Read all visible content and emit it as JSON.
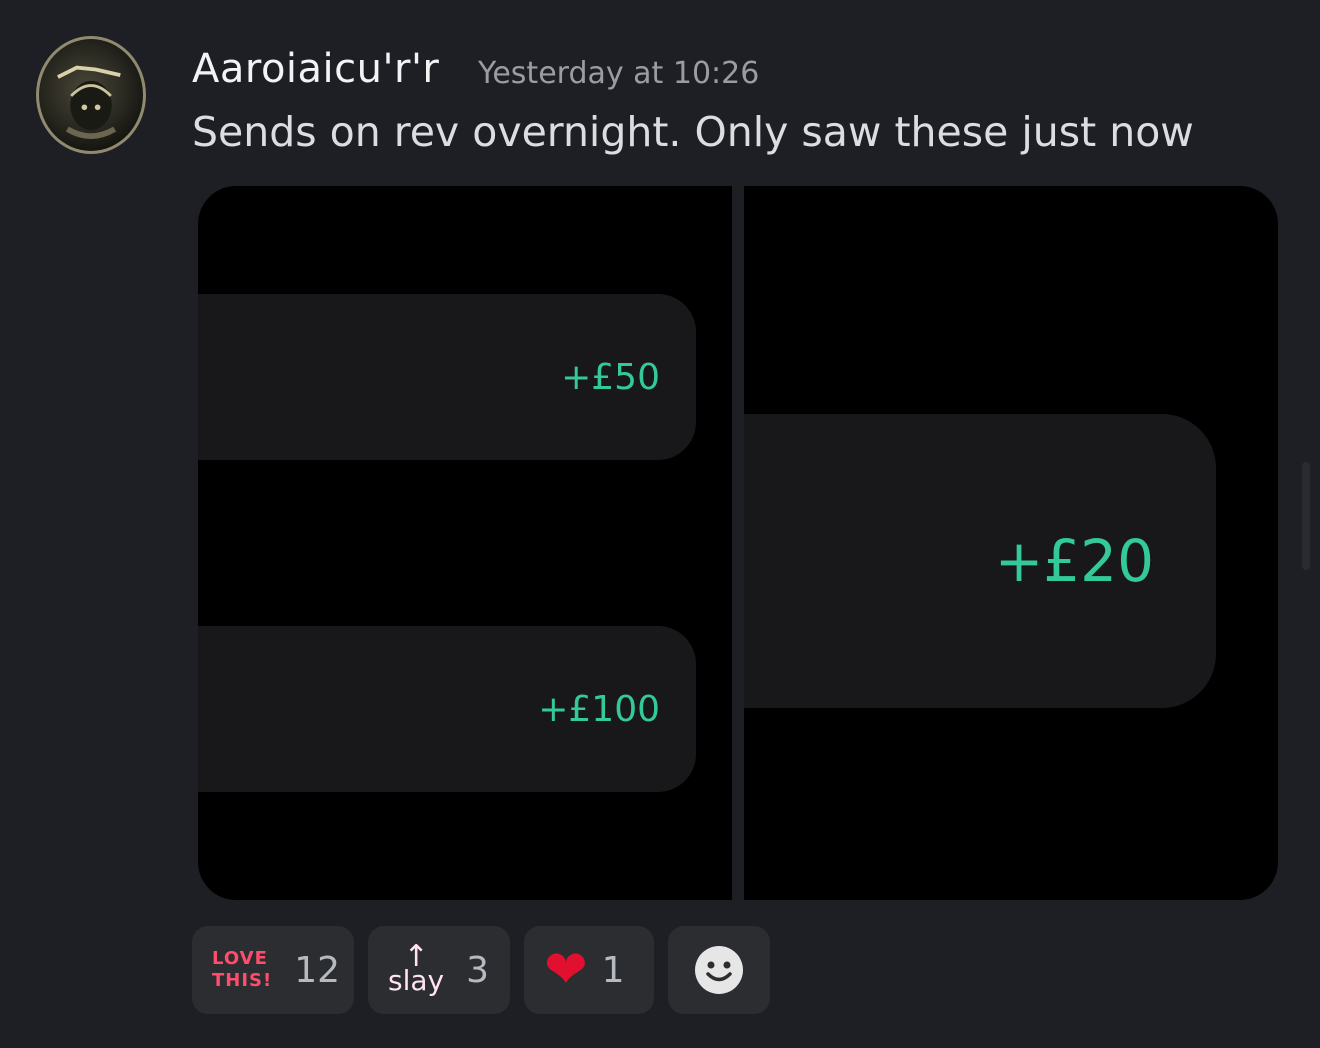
{
  "message": {
    "username": "Aaroiaicu'r'r",
    "timestamp": "Yesterday at 10:26",
    "text": "Sends on rev overnight. Only saw these just now"
  },
  "attachments": {
    "left": {
      "transactions": [
        {
          "amount": "+£50"
        },
        {
          "amount": "+£100"
        }
      ]
    },
    "right": {
      "transactions": [
        {
          "amount": "+£20"
        }
      ]
    }
  },
  "reactions": [
    {
      "emoji": "love-this",
      "label": "LOVE THIS!",
      "count": "12"
    },
    {
      "emoji": "slay-arrow",
      "label": "slay",
      "symbol": "↑",
      "count": "3"
    },
    {
      "emoji": "red-heart",
      "symbol": "❤",
      "count": "1"
    },
    {
      "emoji": "add-reaction-icon"
    }
  ],
  "colors": {
    "background": "#1e1f24",
    "amount_green": "#34c99b",
    "reaction_bg": "#2b2d31"
  }
}
